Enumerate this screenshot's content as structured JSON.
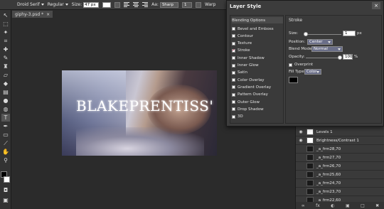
{
  "options_bar": {
    "font": "Droid Serif",
    "weight": "Regular",
    "size_label": "Size:",
    "size_value": "47 px",
    "aa_label": "Aa:",
    "aa_value": "Sharp",
    "leading_value": "1",
    "warp_label": "Warp"
  },
  "document": {
    "tab_label": "giphy-3.psd *",
    "close": "×",
    "canvas_text": "BLAKEPRENTISS'"
  },
  "dialog": {
    "title": "Layer Style",
    "close": "×",
    "blending": {
      "header": "Blending Options",
      "items": [
        {
          "label": "Bevel and Emboss",
          "checked": false
        },
        {
          "label": "Contour",
          "checked": false
        },
        {
          "label": "Texture",
          "checked": false
        },
        {
          "label": "Stroke",
          "checked": true
        },
        {
          "label": "Inner Shadow",
          "checked": false
        },
        {
          "label": "Inner Glow",
          "checked": false
        },
        {
          "label": "Satin",
          "checked": false
        },
        {
          "label": "Color Overlay",
          "checked": false
        },
        {
          "label": "Gradient Overlay",
          "checked": false
        },
        {
          "label": "Pattern Overlay",
          "checked": false
        },
        {
          "label": "Outer Glow",
          "checked": false
        },
        {
          "label": "Drop Shadow",
          "checked": false
        },
        {
          "label": "3D",
          "checked": false
        }
      ]
    },
    "stroke": {
      "heading": "Stroke",
      "size_label": "Size:",
      "size_value": "1",
      "size_unit": "px",
      "position_label": "Position:",
      "position_value": "Center",
      "blend_label": "Blend Mode:",
      "blend_value": "Normal",
      "opacity_label": "Opacity:",
      "opacity_value": "100",
      "opacity_unit": "%",
      "overprint_label": "Overprint",
      "fill_label": "Fill Type:",
      "fill_value": "Color",
      "stroke_color": "#000000"
    }
  },
  "layers": {
    "items": [
      {
        "name": "Levels 1",
        "visible": true,
        "thumb": "white"
      },
      {
        "name": "Brightness/Contrast 1",
        "visible": true,
        "thumb": "white"
      },
      {
        "name": "_a_frm28,70",
        "visible": false,
        "thumb": "dark"
      },
      {
        "name": "_a_frm27,70",
        "visible": false,
        "thumb": "dark"
      },
      {
        "name": "_a_frm26,70",
        "visible": false,
        "thumb": "dark"
      },
      {
        "name": "_a_frm25,60",
        "visible": false,
        "thumb": "dark"
      },
      {
        "name": "_a_frm24,70",
        "visible": false,
        "thumb": "dark"
      },
      {
        "name": "_a_frm23,70",
        "visible": false,
        "thumb": "dark"
      },
      {
        "name": "_a_frm22,60",
        "visible": false,
        "thumb": "dark"
      }
    ]
  },
  "colors": {
    "foreground": "#000000",
    "background": "#ffffff"
  }
}
